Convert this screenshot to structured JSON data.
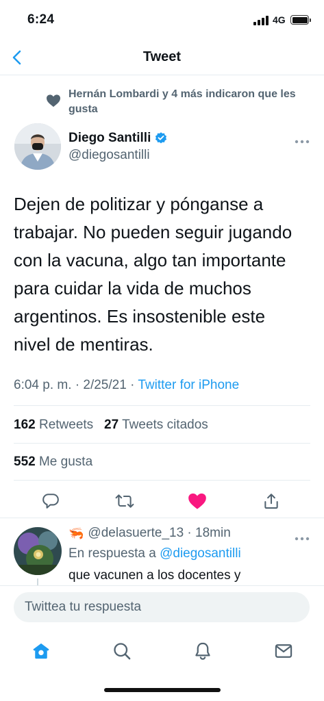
{
  "status_bar": {
    "time": "6:24",
    "network": "4G"
  },
  "nav": {
    "title": "Tweet",
    "back_icon": "chevron-left-icon"
  },
  "social_context": {
    "icon": "heart-icon",
    "text": "Hernán Lombardi y 4 más indicaron que les gusta"
  },
  "tweet": {
    "author_name": "Diego Santilli",
    "author_handle": "@diegosantilli",
    "verified": true,
    "text_lines": [
      "Dejen de politizar y pónganse a",
      "trabajar. No pueden seguir jugando",
      "con la vacuna, algo tan importante",
      "para cuidar la vida de muchos",
      "argentinos. Es insostenible este",
      "nivel de mentiras."
    ],
    "time": "6:04 p. m.",
    "date": "2/25/21",
    "source": "Twitter for iPhone",
    "retweets_count": "162",
    "retweets_label": "Retweets",
    "quotes_count": "27",
    "quotes_label": "Tweets citados",
    "likes_count": "552",
    "likes_label": "Me gusta",
    "liked": true
  },
  "reply": {
    "handle": "@delasuerte_13",
    "time": "18min",
    "replying_prefix": "En respuesta a",
    "replying_to": "@diegosantilli",
    "text": "que vacunen a los docentes y"
  },
  "compose": {
    "placeholder": "Twittea tu respuesta"
  },
  "colors": {
    "accent": "#1d9bf0",
    "like": "#f91880",
    "secondary_text": "#536471"
  }
}
